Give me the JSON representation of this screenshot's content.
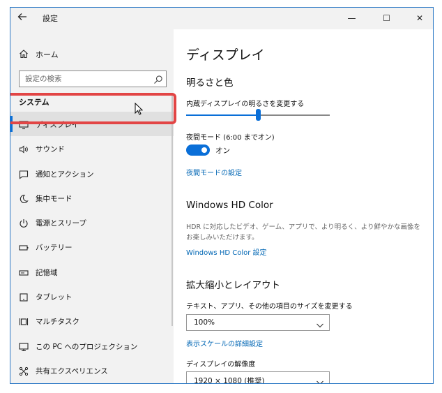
{
  "window": {
    "title": "設定",
    "back_icon": "back-arrow-icon",
    "controls": {
      "minimize": "—",
      "maximize": "☐",
      "close": "✕"
    }
  },
  "sidebar": {
    "home": {
      "label": "ホーム",
      "icon": "home-icon"
    },
    "search": {
      "placeholder": "設定の検索",
      "icon": "search-icon"
    },
    "section": "システム",
    "items": [
      {
        "label": "ディスプレイ",
        "icon": "monitor-icon",
        "active": true
      },
      {
        "label": "サウンド",
        "icon": "speaker-icon"
      },
      {
        "label": "通知とアクション",
        "icon": "notification-icon"
      },
      {
        "label": "集中モード",
        "icon": "moon-icon"
      },
      {
        "label": "電源とスリープ",
        "icon": "power-icon"
      },
      {
        "label": "バッテリー",
        "icon": "battery-icon"
      },
      {
        "label": "記憶域",
        "icon": "storage-icon"
      },
      {
        "label": "タブレット",
        "icon": "tablet-icon"
      },
      {
        "label": "マルチタスク",
        "icon": "multitask-icon"
      },
      {
        "label": "この PC へのプロジェクション",
        "icon": "projection-icon"
      },
      {
        "label": "共有エクスペリエンス",
        "icon": "share-icon"
      }
    ]
  },
  "main": {
    "title": "ディスプレイ",
    "brightness": {
      "heading": "明るさと色",
      "slider_label": "内蔵ディスプレイの明るさを変更する",
      "slider_value": 0.5,
      "night_light_label": "夜間モード (6:00 までオン)",
      "toggle_state": "オン",
      "night_light_settings_link": "夜間モードの設定"
    },
    "hdr": {
      "heading": "Windows HD Color",
      "description": "HDR に対応したビデオ、ゲーム、アプリで、より明るく、より鮮やかな画像をお楽しみいただけます。",
      "link": "Windows HD Color 設定"
    },
    "layout": {
      "heading": "拡大縮小とレイアウト",
      "scale_label": "テキスト、アプリ、その他の項目のサイズを変更する",
      "scale_value": "100%",
      "advanced_link": "表示スケールの詳細設定",
      "resolution_label": "ディスプレイの解像度",
      "resolution_value": "1920 × 1080 (推奨)"
    }
  },
  "colors": {
    "accent": "#0a6fd8",
    "link": "#0066b4",
    "highlight": "#e24545",
    "sidebar_bg": "#f2f2f2"
  }
}
